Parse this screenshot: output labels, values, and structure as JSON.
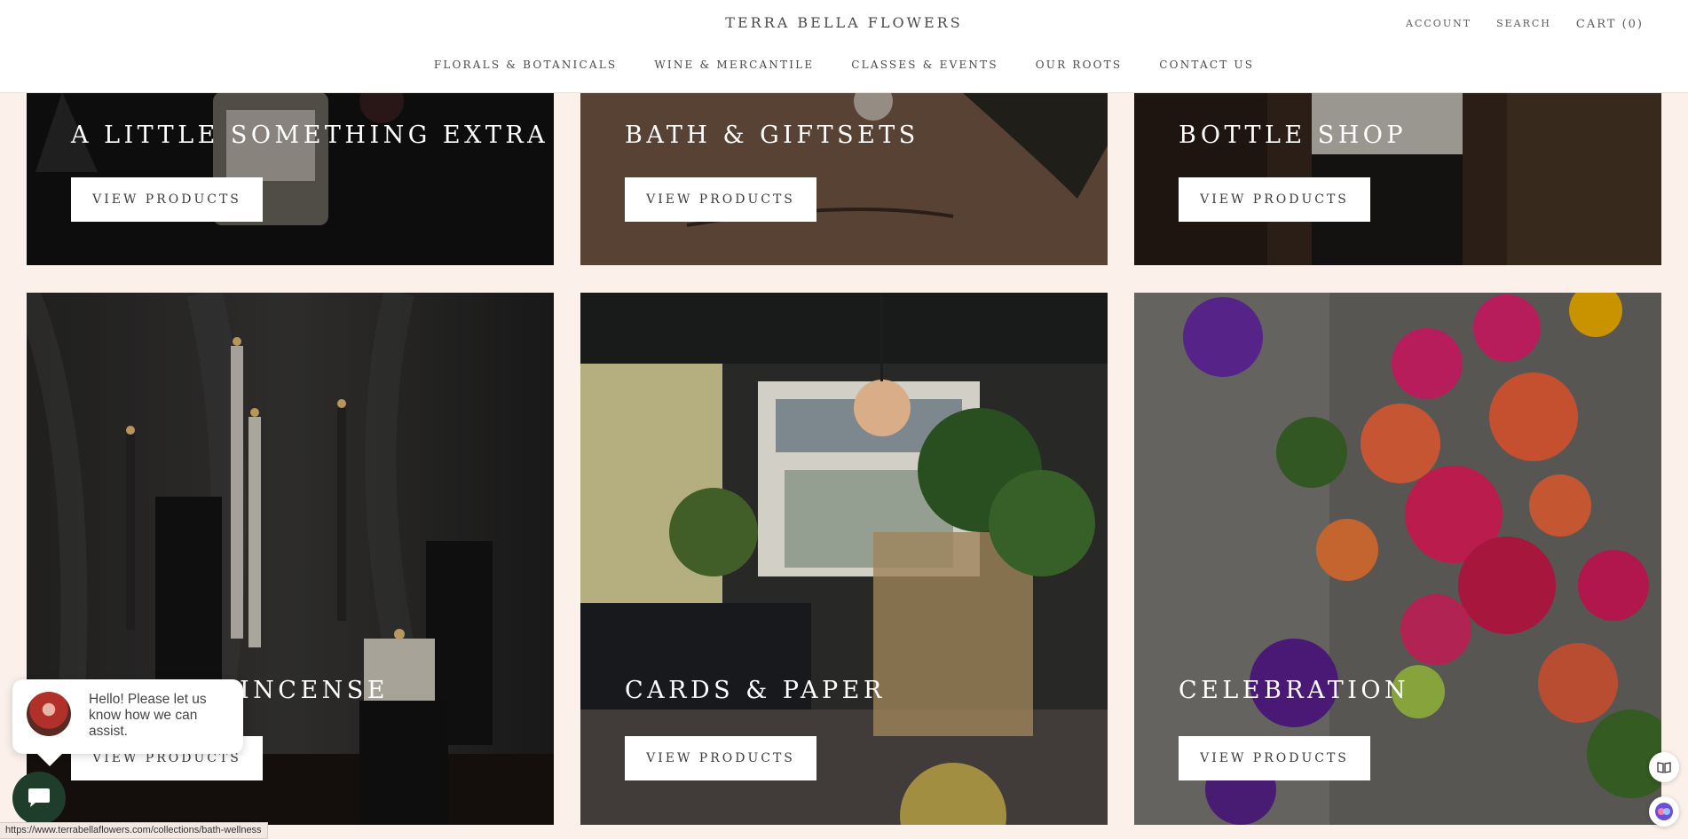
{
  "header": {
    "brand": "TERRA BELLA FLOWERS",
    "utility": {
      "account": "ACCOUNT",
      "search": "SEARCH",
      "cart": "CART (0)"
    },
    "nav": [
      "FLORALS & BOTANICALS",
      "WINE & MERCANTILE",
      "CLASSES & EVENTS",
      "OUR ROOTS",
      "CONTACT US"
    ]
  },
  "tiles": [
    {
      "title": "A LITTLE SOMETHING EXTRA",
      "button": "VIEW PRODUCTS"
    },
    {
      "title": "BATH & GIFTSETS",
      "button": "VIEW PRODUCTS"
    },
    {
      "title": "BOTTLE SHOP",
      "button": "VIEW PRODUCTS"
    },
    {
      "title": "INCENSE",
      "button": "VIEW PRODUCTS"
    },
    {
      "title": "CARDS & PAPER",
      "button": "VIEW PRODUCTS"
    },
    {
      "title": "CELEBRATION",
      "button": "VIEW PRODUCTS"
    }
  ],
  "chat": {
    "message": "Hello! Please let us know how we can assist."
  },
  "status_url": "https://www.terrabellaflowers.com/collections/bath-wellness",
  "icons": {
    "chat_launcher": "chat-icon",
    "reader": "reader-icon",
    "accessibility": "accessibility-icon"
  }
}
